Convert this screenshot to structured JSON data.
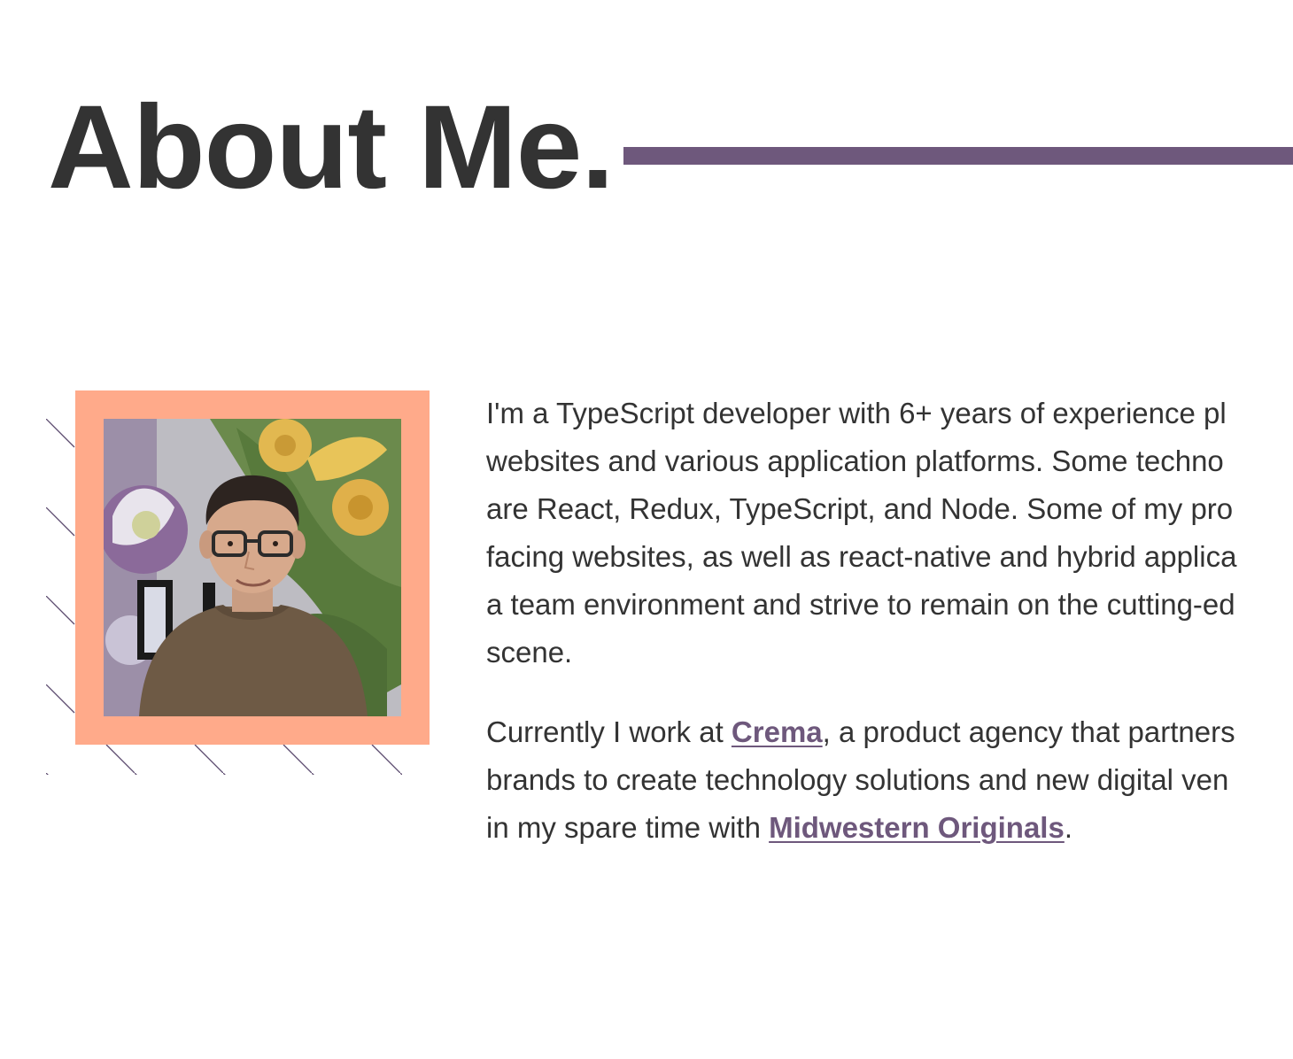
{
  "header": {
    "title": "About Me."
  },
  "colors": {
    "accent": "#6e587c",
    "frame": "#ffaa8a",
    "text": "#333333"
  },
  "photo": {
    "subject": "portrait photo of a smiling man with glasses in front of a floral mural"
  },
  "bio": {
    "paragraph1": {
      "lines": [
        "I'm a TypeScript developer with 6+ years of experience pl",
        "websites and various application platforms. Some techno",
        "are React, Redux, TypeScript, and Node. Some of my pro",
        "facing websites, as well as react-native and hybrid applica",
        "a team environment and strive to remain on the cutting-ed",
        "scene."
      ]
    },
    "paragraph2": {
      "line1_before": "Currently I work at ",
      "link_crema": "Crema",
      "line1_after": ", a product agency that partners",
      "line2": "brands to create technology solutions and new digital ven",
      "line3_before": "in my spare time with ",
      "link_midwestern": "Midwestern Originals",
      "line3_after": "."
    }
  }
}
